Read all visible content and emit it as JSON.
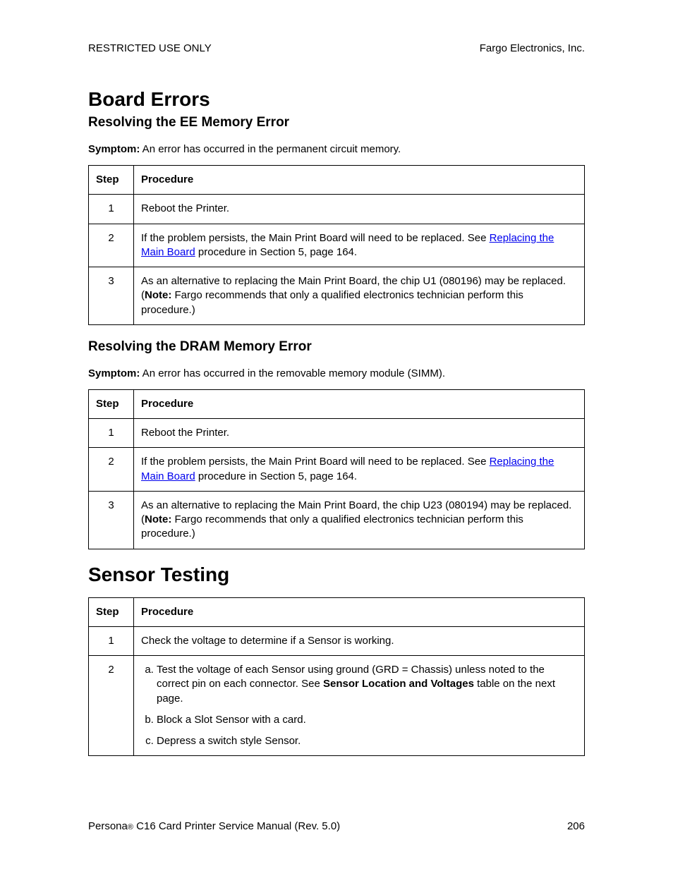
{
  "header": {
    "left": "RESTRICTED USE ONLY",
    "right": "Fargo Electronics, Inc."
  },
  "section1": {
    "title": "Board Errors",
    "sub1": {
      "heading": "Resolving the EE Memory Error",
      "symptom_label": "Symptom:",
      "symptom_text": "  An error has occurred in the permanent circuit memory.",
      "col_step": "Step",
      "col_proc": "Procedure",
      "rows": {
        "r1": {
          "step": "1",
          "proc": "Reboot the Printer."
        },
        "r2": {
          "step": "2",
          "proc_a": "If the problem persists, the Main Print Board will need to be replaced. See ",
          "link": "Replacing the Main Board",
          "proc_b": " procedure in Section 5, page 164."
        },
        "r3": {
          "step": "3",
          "proc_a": "As an alternative to replacing the Main Print Board, the chip U1 (080196) may be replaced. (",
          "note_label": "Note:",
          "proc_b": "  Fargo recommends that only a qualified electronics technician perform this procedure.)"
        }
      }
    },
    "sub2": {
      "heading": "Resolving the DRAM Memory Error",
      "symptom_label": "Symptom:",
      "symptom_text": "  An error has occurred in the removable memory module (SIMM).",
      "col_step": "Step",
      "col_proc": "Procedure",
      "rows": {
        "r1": {
          "step": "1",
          "proc": "Reboot the Printer."
        },
        "r2": {
          "step": "2",
          "proc_a": "If the problem persists, the Main Print Board will need to be replaced. See ",
          "link": "Replacing the Main Board",
          "proc_b": " procedure in Section 5, page 164."
        },
        "r3": {
          "step": "3",
          "proc_a": "As an alternative to replacing the Main Print Board, the chip U23 (080194) may be replaced. (",
          "note_label": "Note:",
          "proc_b": "  Fargo recommends that only a qualified electronics technician perform this procedure.)"
        }
      }
    }
  },
  "section2": {
    "title": "Sensor Testing",
    "col_step": "Step",
    "col_proc": "Procedure",
    "rows": {
      "r1": {
        "step": "1",
        "proc": "Check the voltage to determine if a Sensor is working."
      },
      "r2": {
        "step": "2",
        "a_pre": "Test the voltage of each Sensor using ground (GRD = Chassis) unless noted to the correct pin on each connector. See ",
        "a_bold": "Sensor Location and Voltages",
        "a_post": " table on the next page.",
        "b": "Block a Slot Sensor with a card.",
        "c": "Depress a switch style Sensor."
      }
    }
  },
  "footer": {
    "left_a": "Persona",
    "left_reg": "®",
    "left_b": " C16 Card Printer Service Manual (Rev. 5.0)",
    "right": "206"
  }
}
